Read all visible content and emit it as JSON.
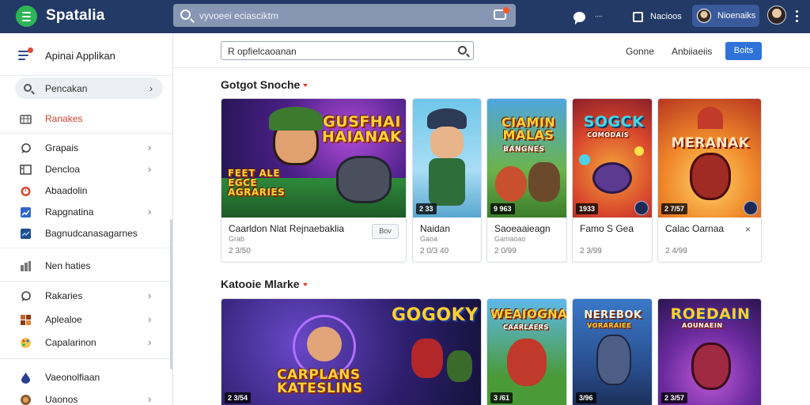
{
  "header": {
    "app_name": "Spatalia",
    "search_placeholder": "vyvoeei eciasciktm",
    "chat_label": "ᐧᐧᐧᐧ",
    "app_link": "Nacioos",
    "profile_label": "Nioenaiks"
  },
  "sidebar": {
    "title": "Apinai Applikan",
    "search_label": "Pencakan",
    "items": [
      {
        "label": "Ranakes",
        "icon": "library-icon"
      },
      {
        "label": "Grapais",
        "icon": "rocket-icon"
      },
      {
        "label": "Dencloa",
        "icon": "grid-icon"
      },
      {
        "label": "Abaadolin",
        "icon": "timer-icon"
      },
      {
        "label": "Rapgnatina",
        "icon": "chart-icon"
      },
      {
        "label": "Bagnudcanasagarnes",
        "icon": "trend-icon"
      },
      {
        "label": "Nen haties",
        "icon": "bars-icon"
      },
      {
        "label": "Rakaries",
        "icon": "rocket-icon"
      },
      {
        "label": "Aplealoe",
        "icon": "blocks-icon"
      },
      {
        "label": "Capalarinon",
        "icon": "palette-icon"
      },
      {
        "label": "Vaeonolfiaan",
        "icon": "drop-icon"
      },
      {
        "label": "Uaonos",
        "icon": "coin-icon"
      }
    ]
  },
  "toolbar": {
    "filter_placeholder": "R opfielcaoanan",
    "link1": "Gonne",
    "link2": "Anbiiaeiis",
    "button": "Boits"
  },
  "sections": [
    {
      "title": "Gotgot Snoche",
      "cards": [
        {
          "art_title": "GUSFHAI HAIANAK",
          "art_sub": "FEET ALE EGCE AGRARIES",
          "name": "Caarldon Nlat Rejnaebaklia",
          "sub": "Grab",
          "price": "2 3/50",
          "button": "Bov"
        },
        {
          "badge": "2 33",
          "name": "Naidan",
          "sub": "Gaoa",
          "price": "2 0/3 40"
        },
        {
          "art_title": "CIAMIN MALAS",
          "art_sub": "BANGNES",
          "badge": "9 963",
          "name": "Saoeaaieagn",
          "sub": "Gamaoao",
          "price": "2 0/99"
        },
        {
          "art_title": "SOGCK",
          "art_sub": "COMODAIS",
          "badge": "1933",
          "name": "Famo S Gea",
          "price": "2 3/99"
        },
        {
          "art_title": "MERANAK",
          "badge": "2 7/57",
          "name": "Calac Oarnaa",
          "price": "2 4/99",
          "button": "×"
        }
      ]
    },
    {
      "title": "Katooie Mlarke",
      "cards": [
        {
          "art_title": "GOGOKY",
          "art_sub": "CARPLANS   KATESLINS",
          "badge": "2 3/54"
        },
        {
          "art_title": "WEAIOGNAK",
          "art_sub": "CAARLAERS",
          "badge": "3 /61"
        },
        {
          "art_title": "NEREBOK",
          "art_sub": "VORARAIEE",
          "badge": "3/96"
        },
        {
          "art_title": "ROEDAIN",
          "art_sub": "AOUNAEIN",
          "badge": "2 3/57"
        }
      ]
    }
  ],
  "colors": {
    "header_bg": "#233a66",
    "accent": "#2f73d9",
    "active": "#c8432e"
  }
}
